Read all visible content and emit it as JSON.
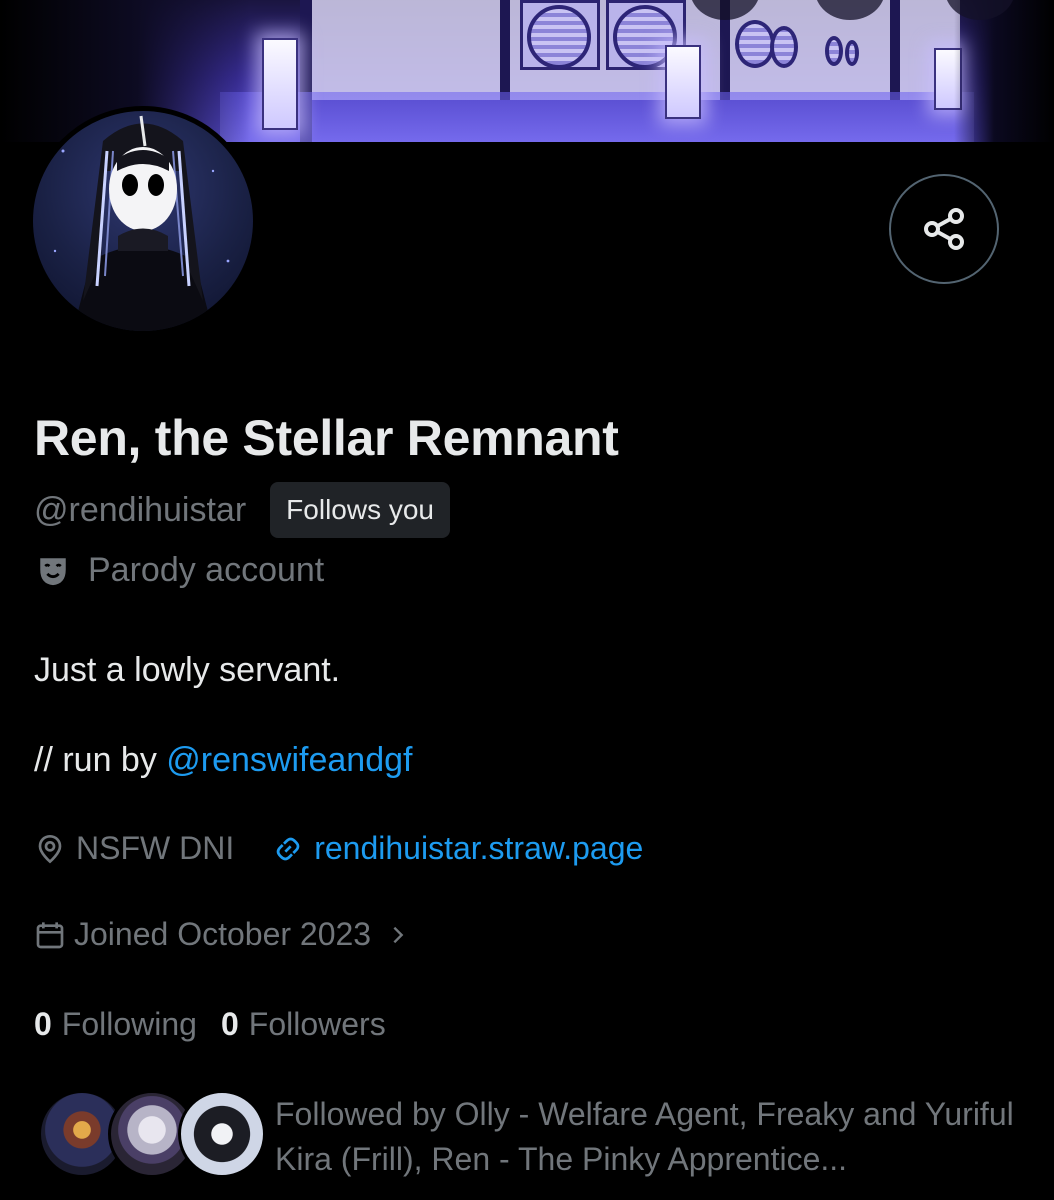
{
  "profile": {
    "display_name": "Ren, the Stellar Remnant",
    "handle": "@rendihuistar",
    "follows_you_badge": "Follows you",
    "label": "Parody account"
  },
  "bio": {
    "line1": "Just a lowly servant.",
    "line2_prefix": "// run by ",
    "line2_mention": "@renswifeandgf"
  },
  "meta": {
    "location": "NSFW DNI",
    "website": "rendihuistar.straw.page",
    "joined": "Joined October 2023"
  },
  "stats": {
    "following_count": "0",
    "following_label": "Following",
    "followers_count": "0",
    "followers_label": "Followers"
  },
  "followed_by": {
    "text": "Followed by Olly - Welfare Agent, Freaky and Yuriful Kira (Frill), Ren - The Pinky Apprentice..."
  },
  "colors": {
    "background": "#000000",
    "primary_text": "#e7e9ea",
    "secondary_text": "#71767b",
    "link": "#1d9bf0",
    "badge_bg": "#202327"
  },
  "icons": {
    "share": "share-icon",
    "parody": "theater-mask-icon",
    "location": "location-pin-icon",
    "link": "link-icon",
    "calendar": "calendar-icon",
    "chevron": "chevron-right-icon"
  }
}
